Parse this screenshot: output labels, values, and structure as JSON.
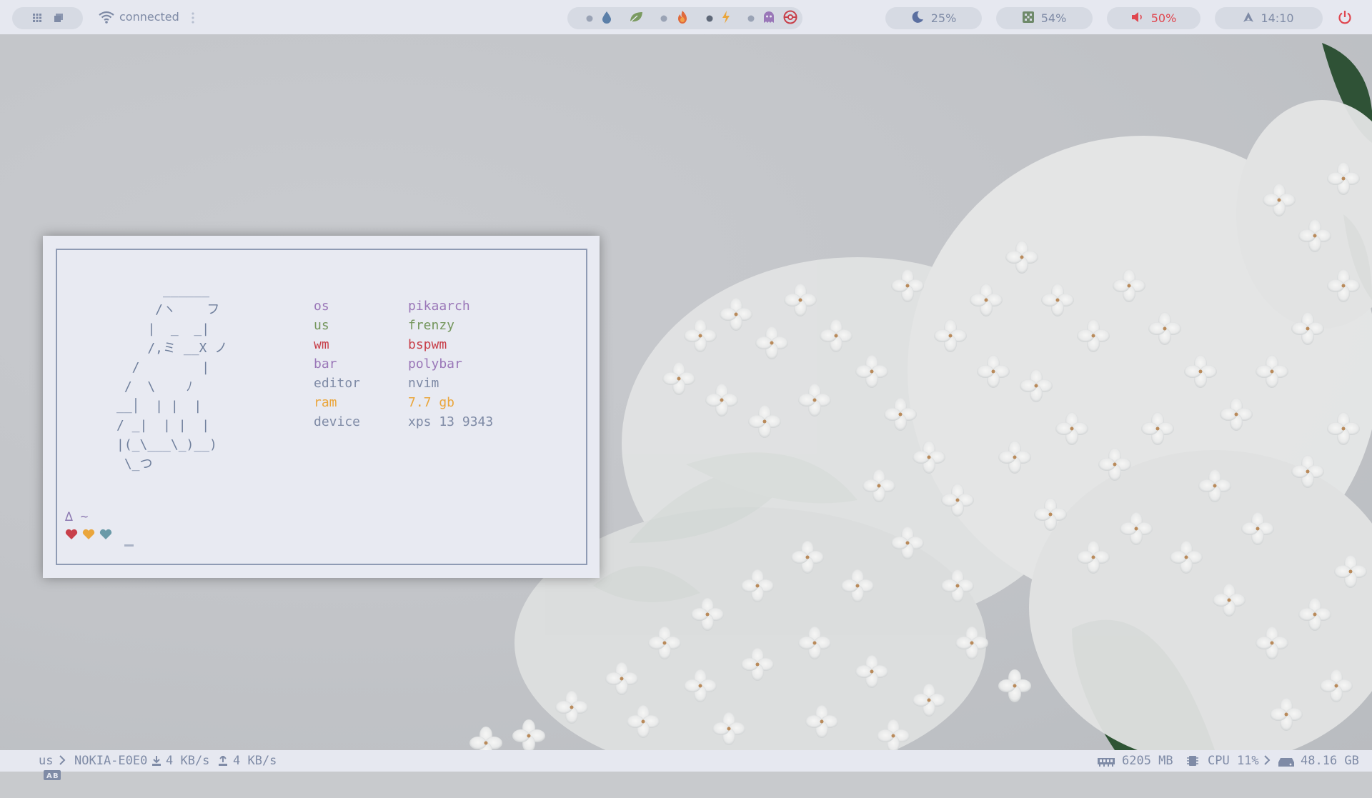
{
  "topbar": {
    "network_status": "connected",
    "brightness": "25%",
    "memory": "54%",
    "volume": "50%",
    "clock": "14:10",
    "workspace_icons": [
      "grid-icon",
      "windows-icon"
    ],
    "status_icons": [
      "dot",
      "water-drop-icon",
      "leaf-icon",
      "dot",
      "fire-icon",
      "dot",
      "lightning-icon",
      "dot",
      "ghost-icon",
      "pokeball-icon"
    ]
  },
  "terminal": {
    "ascii_art": "      ______\n     /ヽ    フ\n    |  _  _|\n    /,ミ __X ノ\n  /        |\n /  \\    ﾉ\n__│  | |  |\n/ _|  | |  |\n|(_\\___\\_)__)\n \\_つ",
    "info": [
      {
        "key": "os",
        "value": "pikaarch",
        "key_color": "#9a77b8",
        "value_color": "#9a77b8"
      },
      {
        "key": "us",
        "value": "frenzy",
        "key_color": "#74965c",
        "value_color": "#74965c"
      },
      {
        "key": "wm",
        "value": "bspwm",
        "key_color": "#c8404a",
        "value_color": "#c8404a"
      },
      {
        "key": "bar",
        "value": "polybar",
        "key_color": "#9a77b8",
        "value_color": "#9a77b8"
      },
      {
        "key": "editor",
        "value": "nvim",
        "key_color": "#7f8ba6",
        "value_color": "#7f8ba6"
      },
      {
        "key": "ram",
        "value": "7.7 gb",
        "key_color": "#eaa63c",
        "value_color": "#eaa63c"
      },
      {
        "key": "device",
        "value": "xps 13 9343",
        "key_color": "#7f8ba6",
        "value_color": "#7f8ba6"
      }
    ],
    "prompt": "∆ ~"
  },
  "bottombar": {
    "layout": "us",
    "network_name": "NOKIA-E0E0",
    "download": "4 KB/s",
    "upload": "4 KB/s",
    "ram": "6205 MB",
    "cpu": "CPU 11%",
    "disk": "48.16 GB",
    "keyboard_icon_text": "A⃞"
  },
  "colors": {
    "bar_bg": "#e6e8f0",
    "pill_bg": "#d6dae3",
    "text": "#7f8ba6",
    "red": "#c8404a",
    "orange": "#eaa63c",
    "purple": "#9a77b8",
    "teal": "#6a9aa8"
  }
}
